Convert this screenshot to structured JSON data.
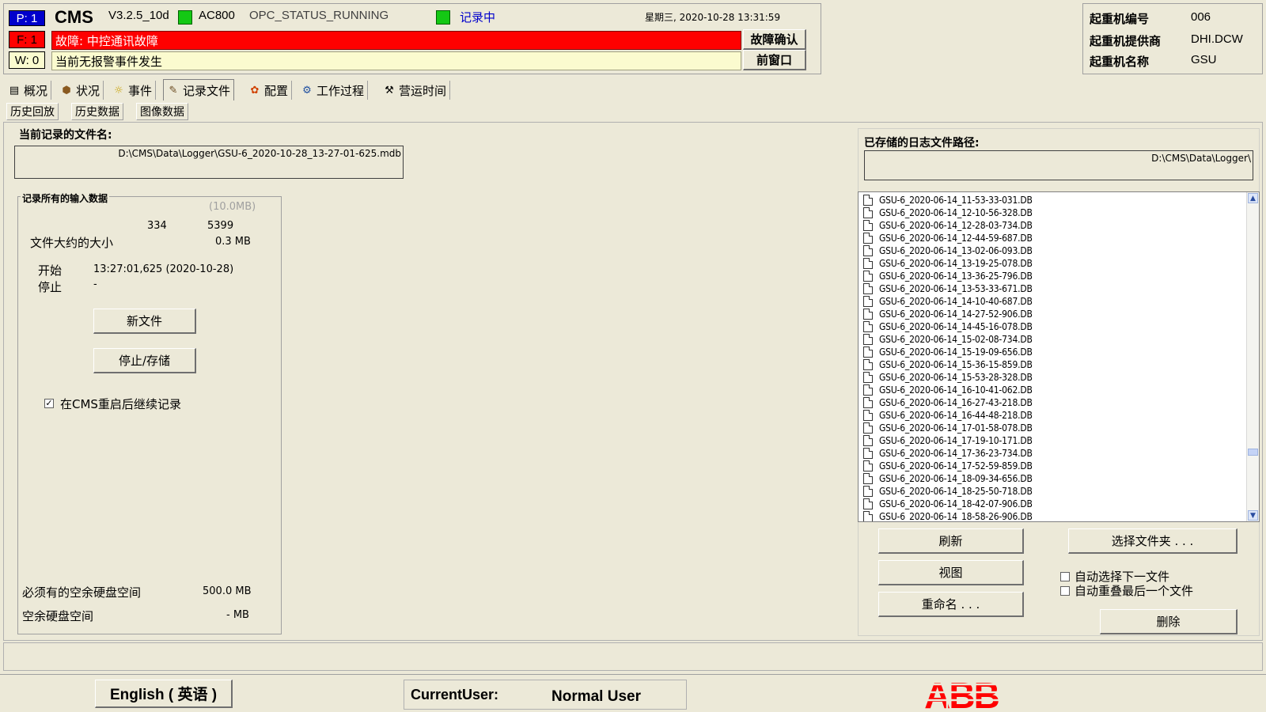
{
  "header": {
    "p_badge": "P: 1",
    "app_name": "CMS",
    "version": "V3.2.5_10d",
    "controller": "AC800",
    "opc_status": "OPC_STATUS_RUNNING",
    "recording_label": "记录中",
    "datetime": "星期三, 2020-10-28  13:31:59",
    "f_badge": "F: 1",
    "fault_text": "故障: 中控通讯故障",
    "w_badge": "W: 0",
    "warn_text": "当前无报警事件发生",
    "ack_button": "故障确认",
    "prev_window_button": "前窗口"
  },
  "crane": {
    "id_label": "起重机编号",
    "id_value": "006",
    "supplier_label": "起重机提供商",
    "supplier_value": "DHI.DCW",
    "name_label": "起重机名称",
    "name_value": "GSU"
  },
  "tabs": [
    {
      "label": "概况",
      "icon": "overview-icon"
    },
    {
      "label": "状况",
      "icon": "status-icon"
    },
    {
      "label": "事件",
      "icon": "event-icon"
    },
    {
      "label": "记录文件",
      "icon": "record-file-icon"
    },
    {
      "label": "配置",
      "icon": "config-icon"
    },
    {
      "label": "工作过程",
      "icon": "work-process-icon"
    },
    {
      "label": "营运时间",
      "icon": "operating-time-icon"
    }
  ],
  "subtabs": [
    "历史回放",
    "历史数据",
    "图像数据"
  ],
  "recording": {
    "current_file_label": "当前记录的文件名:",
    "current_file_path": "D:\\CMS\\Data\\Logger\\GSU-6_2020-10-28_13-27-01-625.mdb",
    "group_title": "记录所有的输入数据",
    "max_size": "(10.0MB)",
    "count_a": "334",
    "count_b": "5399",
    "approx_size_label": "文件大约的大小",
    "approx_size_value": "0.3 MB",
    "start_label": "开始",
    "start_value": "13:27:01,625  (2020-10-28)",
    "stop_label": "停止",
    "stop_value": "-",
    "new_file_button": "新文件",
    "stop_save_button": "停止/存储",
    "continue_checkbox_label": "在CMS重启后继续记录",
    "continue_checked": "✓",
    "required_space_label": "必须有的空余硬盘空间",
    "required_space_value": "500.0 MB",
    "free_space_label": "空余硬盘空间",
    "free_space_value": "- MB"
  },
  "log_files": {
    "path_label": "已存储的日志文件路径:",
    "path_value": "D:\\CMS\\Data\\Logger\\",
    "files": [
      "GSU-6_2020-06-14_11-53-33-031.DB",
      "GSU-6_2020-06-14_12-10-56-328.DB",
      "GSU-6_2020-06-14_12-28-03-734.DB",
      "GSU-6_2020-06-14_12-44-59-687.DB",
      "GSU-6_2020-06-14_13-02-06-093.DB",
      "GSU-6_2020-06-14_13-19-25-078.DB",
      "GSU-6_2020-06-14_13-36-25-796.DB",
      "GSU-6_2020-06-14_13-53-33-671.DB",
      "GSU-6_2020-06-14_14-10-40-687.DB",
      "GSU-6_2020-06-14_14-27-52-906.DB",
      "GSU-6_2020-06-14_14-45-16-078.DB",
      "GSU-6_2020-06-14_15-02-08-734.DB",
      "GSU-6_2020-06-14_15-19-09-656.DB",
      "GSU-6_2020-06-14_15-36-15-859.DB",
      "GSU-6_2020-06-14_15-53-28-328.DB",
      "GSU-6_2020-06-14_16-10-41-062.DB",
      "GSU-6_2020-06-14_16-27-43-218.DB",
      "GSU-6_2020-06-14_16-44-48-218.DB",
      "GSU-6_2020-06-14_17-01-58-078.DB",
      "GSU-6_2020-06-14_17-19-10-171.DB",
      "GSU-6_2020-06-14_17-36-23-734.DB",
      "GSU-6_2020-06-14_17-52-59-859.DB",
      "GSU-6_2020-06-14_18-09-34-656.DB",
      "GSU-6_2020-06-14_18-25-50-718.DB",
      "GSU-6_2020-06-14_18-42-07-906.DB",
      "GSU-6_2020-06-14_18-58-26-906.DB"
    ],
    "refresh_button": "刷新",
    "view_button": "视图",
    "rename_button": "重命名 . . .",
    "choose_folder_button": "选择文件夹 . . .",
    "auto_select_label": "自动选择下一文件",
    "auto_overwrite_label": "自动重叠最后一个文件",
    "delete_button": "删除"
  },
  "footer": {
    "language_button": "English ( 英语 )",
    "current_user_label": "CurrentUser:",
    "current_user_value": "Normal User",
    "logo": "ABB"
  },
  "colors": {
    "background": "#ece9d8",
    "fault_red": "#ff0000",
    "warn_yellow": "#fbfbcf",
    "status_green": "#14c814",
    "p_badge_blue": "#0000cc",
    "abb_red": "#ff0000"
  }
}
